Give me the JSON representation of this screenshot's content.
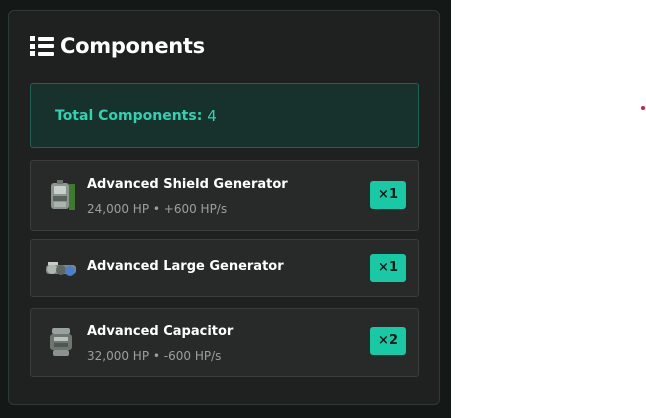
{
  "panel": {
    "title": "Components",
    "title_icon": "list-icon",
    "summary": {
      "label": "Total Components:",
      "value": "4"
    },
    "items": [
      {
        "name": "Advanced Shield Generator",
        "stats": "24,000 HP • +600 HP/s",
        "quantity": "×1",
        "icon": "shield-generator-icon"
      },
      {
        "name": "Advanced Large Generator",
        "stats": "",
        "quantity": "×1",
        "icon": "large-generator-icon"
      },
      {
        "name": "Advanced Capacitor",
        "stats": "32,000 HP • -600 HP/s",
        "quantity": "×2",
        "icon": "capacitor-icon"
      }
    ]
  },
  "colors": {
    "accent": "#17c9a4",
    "summary_text": "#2ed3b0",
    "panel_bg": "#1e2120",
    "item_bg": "#272a29"
  }
}
